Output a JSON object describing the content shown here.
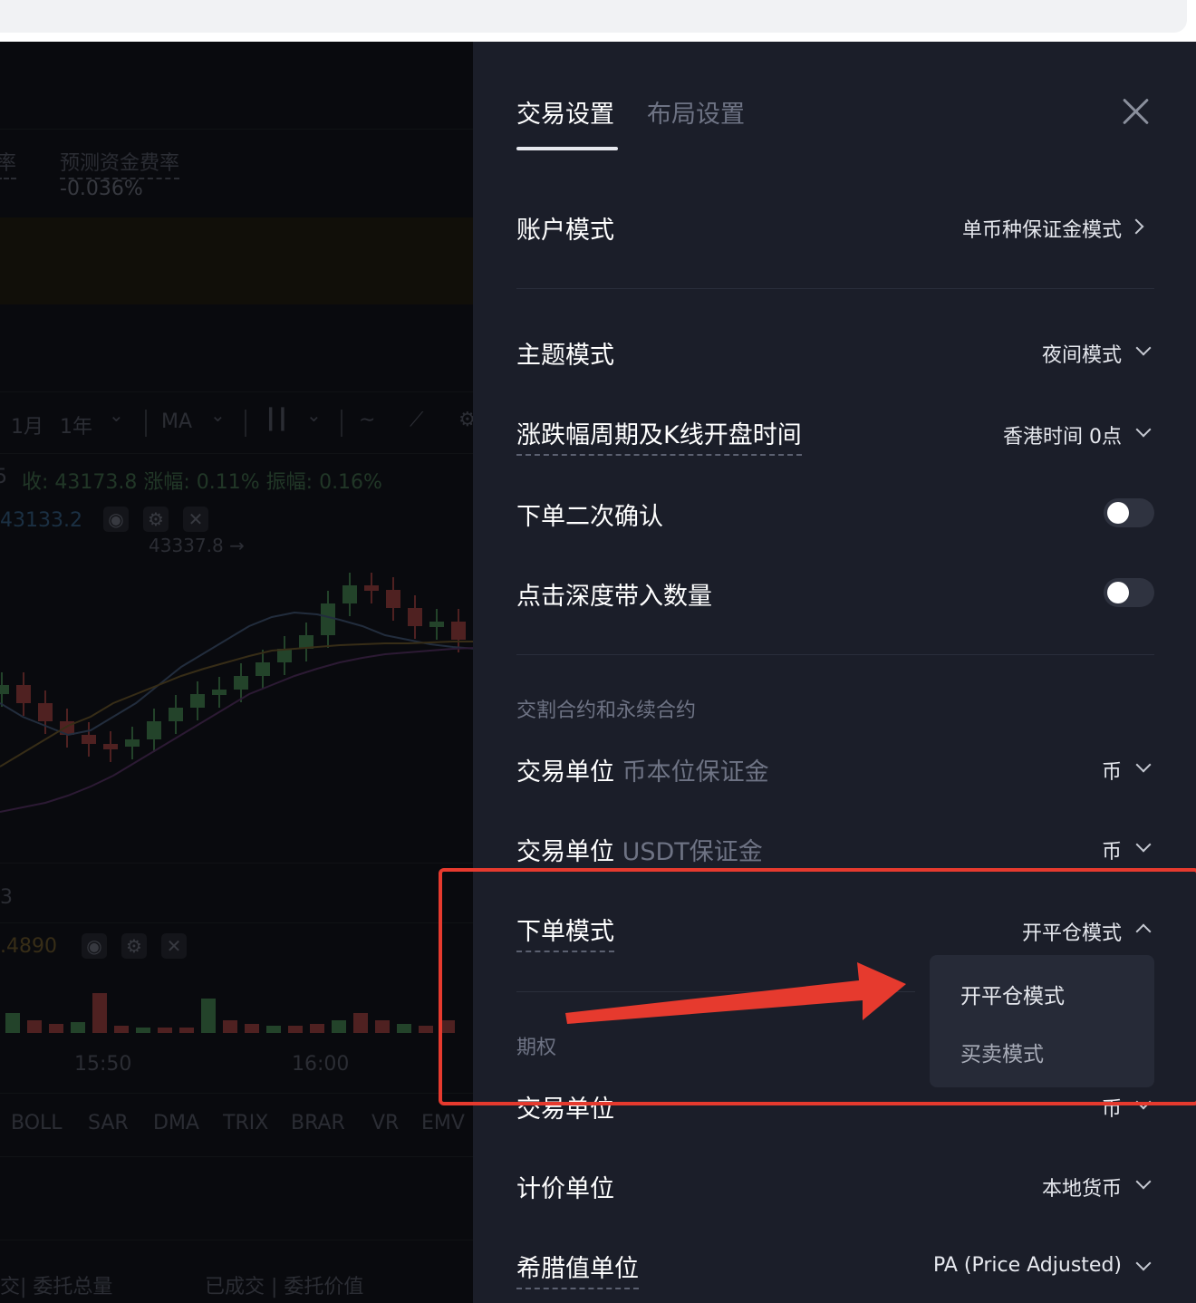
{
  "chart_bg": {
    "funding_partial": "率",
    "funding_label": "预测资金费率",
    "funding_value": "-0.036%",
    "periods": [
      "1月",
      "1年"
    ],
    "ma_label": "MA",
    "ohlc": "收: 43173.8  涨幅: 0.11%  振幅: 0.16%",
    "ohlc_prefix": "5",
    "ma_value": "43133.2",
    "high_marker": "43337.8 →",
    "vol_partial": "3",
    "vol_value": ".4890",
    "times": [
      "15:50",
      "16:00"
    ],
    "indicators": [
      "BOLL",
      "SAR",
      "DMA",
      "TRIX",
      "BRAR",
      "VR",
      "EMV"
    ],
    "order_cols": [
      "交| 委托总量",
      "已成交 | 委托价值"
    ]
  },
  "panel": {
    "tabs": [
      {
        "label": "交易设置",
        "active": true
      },
      {
        "label": "布局设置",
        "active": false
      }
    ],
    "rows": {
      "account_mode": {
        "label": "账户模式",
        "value": "单币种保证金模式"
      },
      "theme_mode": {
        "label": "主题模式",
        "value": "夜间模式"
      },
      "period_kline": {
        "label": "涨跌幅周期及K线开盘时间",
        "value": "香港时间 0点"
      },
      "order_confirm": {
        "label": "下单二次确认",
        "toggle": false
      },
      "depth_qty": {
        "label": "点击深度带入数量",
        "toggle": false
      }
    },
    "section_futures": "交割合约和永续合约",
    "futures_rows": {
      "unit_coin": {
        "label": "交易单位",
        "sub": "币本位保证金",
        "value": "币"
      },
      "unit_usdt": {
        "label": "交易单位",
        "sub": "USDT保证金",
        "value": "币"
      },
      "order_mode": {
        "label": "下单模式",
        "value": "开平仓模式"
      }
    },
    "dropdown": {
      "options": [
        "开平仓模式",
        "买卖模式"
      ],
      "selected": "开平仓模式"
    },
    "section_options": "期权",
    "options_rows": {
      "trade_unit": {
        "label": "交易单位",
        "value": "币"
      },
      "pricing_unit": {
        "label": "计价单位",
        "value": "本地货币"
      },
      "greeks_unit": {
        "label": "希腊值单位",
        "value": "PA (Price Adjusted)"
      }
    }
  },
  "colors": {
    "panel_bg": "#1b1e29",
    "annotation_red": "#e63a2e",
    "candle_up": "#2f5a38",
    "candle_down": "#6a2c2c"
  }
}
